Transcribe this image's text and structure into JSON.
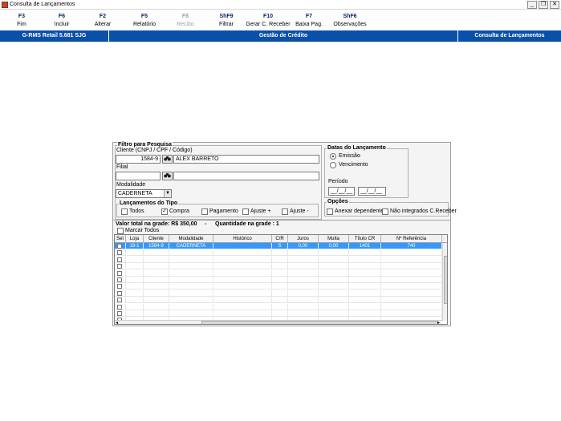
{
  "window": {
    "title": "Consulta de Lançamentos",
    "minimize": "_",
    "restore": "❐",
    "close": "✕"
  },
  "toolbar": [
    {
      "key": "F3",
      "label": "Fim",
      "enabled": true
    },
    {
      "key": "F6",
      "label": "Incluir",
      "enabled": true
    },
    {
      "key": "F2",
      "label": "Alterar",
      "enabled": true
    },
    {
      "key": "F5",
      "label": "Relatório",
      "enabled": true
    },
    {
      "key": "F8",
      "label": "Recibo",
      "enabled": false
    },
    {
      "key": "ShF9",
      "label": "Filtrar",
      "enabled": true
    },
    {
      "key": "F10",
      "label": "Gerar C. Receber",
      "enabled": true
    },
    {
      "key": "F7",
      "label": "Baixa Pag.",
      "enabled": true
    },
    {
      "key": "ShF6",
      "label": "Observações",
      "enabled": true
    }
  ],
  "status": {
    "app": "G-RMS Retail 5.681 SJG",
    "module": "Gestão de Crédito",
    "screen": "Consulta de Lançamentos"
  },
  "filter": {
    "legend": "Filtro para Pesquisa",
    "cliente_label": "Cliente (CNPJ / CPF / Código)",
    "cliente_code": "1584-9",
    "cliente_name": "ALEX BARRETO",
    "filial_label": "Filial",
    "filial_code": "",
    "filial_name": "",
    "modalidade_label": "Modalidade",
    "modalidade_value": "CADERNETA",
    "tipo_legend": "Lançamentos do Tipo",
    "tipos": [
      {
        "label": "Todos",
        "checked": false
      },
      {
        "label": "Compra",
        "checked": true
      },
      {
        "label": "Pagamento",
        "checked": false
      },
      {
        "label": "Ajuste +",
        "checked": false
      },
      {
        "label": "Ajuste -",
        "checked": false
      }
    ]
  },
  "datas": {
    "legend": "Datas do Lançamento",
    "emissao": "Emissão",
    "vencimento": "Vencimento",
    "selected": "emissao",
    "periodo_label": "Período",
    "periodo_inicio": "__/__/__",
    "periodo_fim": "__/__/__"
  },
  "opcoes": {
    "legend": "Opções",
    "anexar": "Anexar dependentes",
    "nao_integrados": "Não integrados C.Receber"
  },
  "summary": {
    "valor_total": "Valor total na grade: R$ 350,00",
    "separator": "-",
    "quantidade": "Quantidade na grade : 1",
    "marcar_todos": "Marcar Todos"
  },
  "grid": {
    "columns": [
      "Sel",
      "Loja",
      "Cliente",
      "Modalidade",
      "Histórico",
      "C/R",
      "Juros",
      "Multa",
      "Título CR",
      "Nº Referência"
    ],
    "rows": [
      [
        "",
        "19-1",
        "1584-9",
        "CADERNETA",
        "",
        "S",
        "0,00",
        "0,00",
        "1401",
        "740"
      ]
    ],
    "empty_rows": 11
  }
}
